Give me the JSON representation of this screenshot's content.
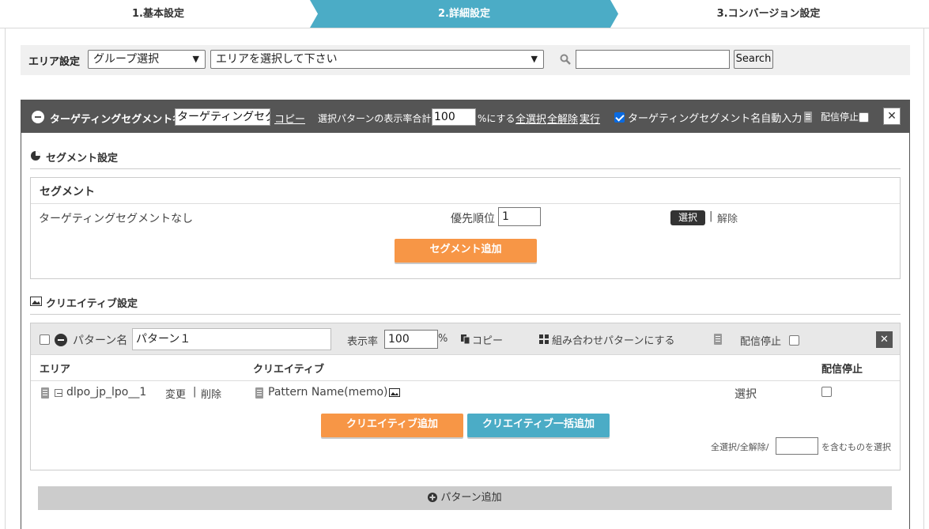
{
  "steps": {
    "step1": "1.基本設定",
    "step2": "2.詳細設定",
    "step3": "3.コンバージョン設定"
  },
  "area_bar": {
    "label": "エリア設定",
    "group_select": "グループ選択",
    "area_select": "エリアを選択して下さい",
    "search_value": "",
    "search_button": "Search"
  },
  "segment_header": {
    "name_label": "ターゲティングセグメント名",
    "name_value": "ターゲティングセグ",
    "copy_link": "コピー",
    "ratio_prefix": "選択パターンの表示率合計を",
    "ratio_value": "100",
    "ratio_suffix": "%にする",
    "select_all": "全選択",
    "deselect_all": "全解除",
    "execute": "実行",
    "auto_name_label": "ターゲティングセグメント名自動入力",
    "auto_name_checked": true,
    "stop_label": "配信停止",
    "close": "✕"
  },
  "segment_settings": {
    "title": "セグメント設定",
    "table_header": "セグメント",
    "row_name": "ターゲティングセグメントなし",
    "priority_label": "優先順位",
    "priority_value": "1",
    "select_button": "選択",
    "separator": "|",
    "release_link": "解除",
    "add_button": "セグメント追加"
  },
  "creative_settings": {
    "title": "クリエイティブ設定",
    "pattern": {
      "name_label": "パターン名",
      "name_value": "パターン１",
      "rate_label": "表示率",
      "rate_value": "100",
      "rate_unit": "%",
      "copy": "コピー",
      "combine": "組み合わせパターンにする",
      "stop_label": "配信停止",
      "close": "✕"
    },
    "columns": {
      "area": "エリア",
      "creative": "クリエイティブ",
      "stop": "配信停止"
    },
    "row": {
      "area_name": "dlpo_jp_lpo__1",
      "change": "変更",
      "separator": "|",
      "delete": "削除",
      "creative_name": "Pattern Name(memo)",
      "select": "選択"
    },
    "add_creative": "クリエイティブ追加",
    "bulk_add_creative": "クリエイティブ一括追加",
    "filter_prefix": "全選択/全解除/",
    "filter_suffix": "を含むものを選択",
    "filter_value": ""
  },
  "add_pattern": "パターン追加",
  "colors": {
    "accent_teal": "#4bacc6",
    "accent_orange": "#f79646",
    "header_dark": "#555555"
  }
}
